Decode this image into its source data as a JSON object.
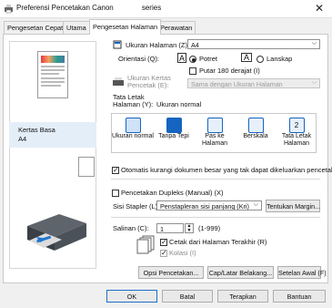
{
  "window": {
    "title": "Preferensi Pencetakan Canon              series",
    "close_label": "✕"
  },
  "tabs": [
    {
      "label": "Pengesetan Cepat"
    },
    {
      "label": "Utama"
    },
    {
      "label": "Pengesetan Halaman"
    },
    {
      "label": "Perawatan"
    }
  ],
  "preview": {
    "paper_label": "Kertas Basa",
    "paper_size": "A4"
  },
  "page_size": {
    "label": "Ukuran Halaman (Z):",
    "value": "A4"
  },
  "orientation": {
    "label": "Orientasi (Q):",
    "portrait": "Potret",
    "landscape": "Lanskap",
    "rotate": "Putar 180 derajat (I)"
  },
  "printer_paper": {
    "label": "Ukuran Kertas Pencetak (E):",
    "value": "Sama dengan Ukuran Halaman"
  },
  "layout": {
    "label": "Tata Letak Halaman (Y):",
    "current": "Ukuran normal",
    "items": [
      {
        "label": "Ukuran normal"
      },
      {
        "label": "Tanpa Tepi"
      },
      {
        "label": "Pas ke Halaman"
      },
      {
        "label": "Berskala"
      },
      {
        "label": "Tata Letak Halaman"
      }
    ]
  },
  "auto_reduce": {
    "label": "Otomatis kurangi dokumen besar yang tak dapat dikeluarkan pencetak"
  },
  "duplex": {
    "label": "Pencetakan Dupleks (Manual) (X)"
  },
  "stapling": {
    "label": "Sisi Stapler (L):",
    "value": "Penstapleran sisi panjang (Kri)",
    "margin_button": "Tentukan Margin..."
  },
  "copies": {
    "label": "Salinan (C):",
    "value": "1",
    "range": "(1-999)",
    "last_page": "Cetak dari Halaman Terakhir (R)",
    "collate": "Kolasi (I)"
  },
  "buttons": {
    "print_options": "Opsi Pencetakan...",
    "stamp": "Cap/Latar Belakang...",
    "defaults": "Setelan Awal (F)",
    "ok": "OK",
    "cancel": "Batal",
    "apply": "Terapkan",
    "help": "Bantuan"
  }
}
